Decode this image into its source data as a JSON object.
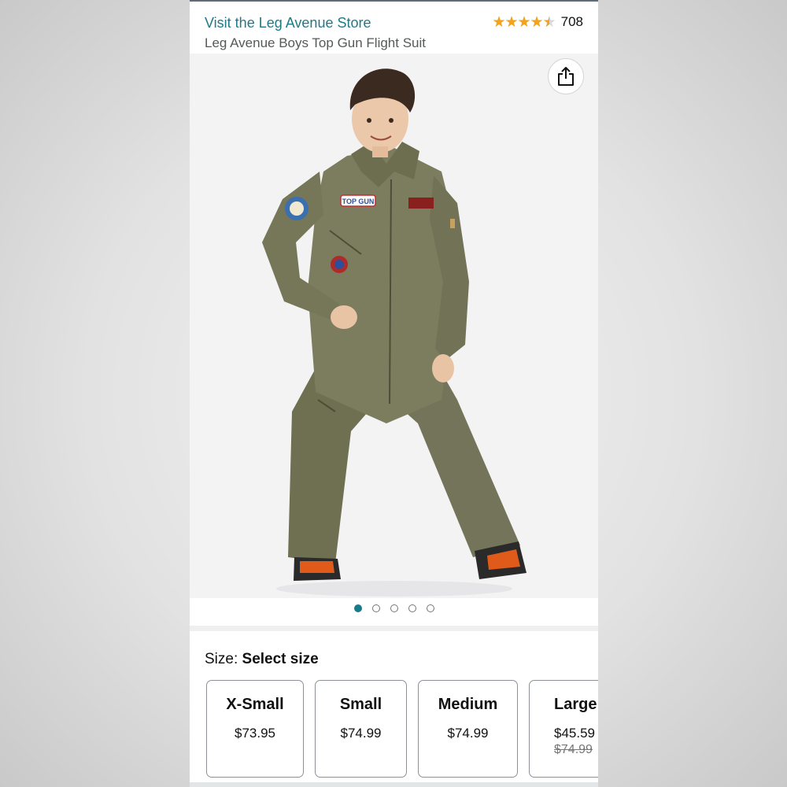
{
  "header": {
    "store_link": "Visit the Leg Avenue Store",
    "rating_value": 4.5,
    "rating_stars": "★★★★★",
    "rating_count": "708",
    "product_title": "Leg Avenue Boys Top Gun Flight Suit"
  },
  "gallery": {
    "share_icon": "share-icon",
    "image_count": 5,
    "active_index": 0,
    "patch_text": "TOP GUN"
  },
  "size_selector": {
    "label": "Size: ",
    "value": "Select size",
    "options": [
      {
        "name": "X-Small",
        "price": "$73.95"
      },
      {
        "name": "Small",
        "price": "$74.99"
      },
      {
        "name": "Medium",
        "price": "$74.99"
      },
      {
        "name": "Large",
        "price": "$45.59",
        "list_price": "$74.99"
      }
    ]
  },
  "colors": {
    "link": "#1f7a86",
    "star": "#f2a31b",
    "active_dot": "#197b8a",
    "suit": "#7a7a5a"
  }
}
